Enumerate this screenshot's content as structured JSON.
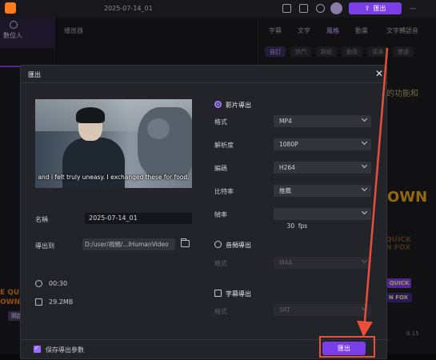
{
  "app": {
    "doc_title": "2025-07-14_01",
    "top_export_label": "匯出",
    "left_tab_label": "數位人",
    "player_title": "播放器",
    "time_readout": "0:15"
  },
  "right_panel": {
    "tabs": [
      "字幕",
      "文字",
      "風格",
      "動畫",
      "文字轉語音"
    ],
    "active_tab_index": 2,
    "pills": [
      "自訂",
      "熱門",
      "群組",
      "動感",
      "填滿",
      "雙語"
    ],
    "active_pill_index": 0,
    "peek_func_text": "的功能和",
    "peek_own_text": "OWN",
    "peek_quick_text": "QUICK\nN FOX",
    "peek_badge1": "QUICK",
    "peek_badge2": "N FOX",
    "peek_left_text": "E QUI\nOWN F",
    "peek_left_btn": "開啟"
  },
  "dialog": {
    "title": "匯出",
    "preview": {
      "subtitle": "and i felt truly uneasy. I exchanged these for food."
    },
    "name_label": "名稱",
    "name_value": "2025-07-14_01",
    "export_to_label": "導出到",
    "export_path": "D:/user/視頻/...IHumanVideo",
    "duration": "00:30",
    "file_size": "29.2MB",
    "video_export": {
      "label": "影片導出",
      "selected": true,
      "fields": [
        {
          "label": "格式",
          "value": "MP4"
        },
        {
          "label": "解析度",
          "value": "1080P"
        },
        {
          "label": "編碼",
          "value": "H264"
        },
        {
          "label": "比特率",
          "value": "推薦"
        },
        {
          "label": "幀率",
          "value": "30  fps"
        }
      ]
    },
    "audio_export": {
      "label": "音頻導出",
      "selected": false,
      "field_label": "格式",
      "field_value": "M4A"
    },
    "subtitle_export": {
      "label": "字幕導出",
      "checked": false,
      "field_label": "格式",
      "field_value": "SRT"
    },
    "save_params_label": "保存導出參數",
    "save_params_checked": true,
    "export_button": "匯出"
  },
  "colors": {
    "accent": "#7b3de8",
    "highlight": "#e8503a",
    "dialog_bg": "#23232a"
  }
}
